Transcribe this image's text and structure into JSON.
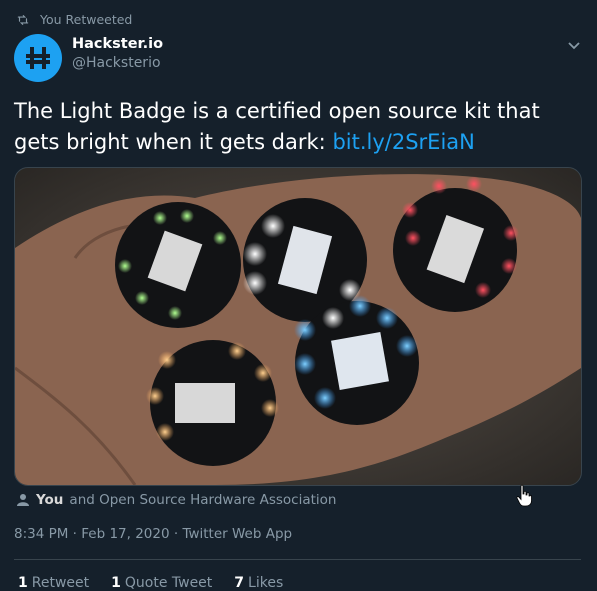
{
  "retweet_label": "You Retweeted",
  "author": {
    "display_name": "Hackster.io",
    "handle": "@Hacksterio"
  },
  "tweet": {
    "text": "The Light Badge is a certified open source kit that gets bright when it gets dark: ",
    "link": "bit.ly/2SrEiaN"
  },
  "media": {
    "description_icon": "photo-of-light-badges",
    "colors": {
      "green": "#7dff5a",
      "white": "#e8f0ff",
      "red": "#ff2a3a",
      "blue": "#3aa0ff",
      "amber": "#ffb060"
    }
  },
  "liked_by": {
    "you": "You",
    "rest": "and Open Source Hardware Association"
  },
  "meta": "8:34 PM · Feb 17, 2020 · Twitter Web App",
  "stats": {
    "retweets_count": "1",
    "retweets_label": "Retweet",
    "quotes_count": "1",
    "quotes_label": "Quote Tweet",
    "likes_count": "7",
    "likes_label": "Likes"
  },
  "theme": {
    "background": "#15202b",
    "accent": "#1da1f2",
    "secondary_text": "#8899a6"
  }
}
